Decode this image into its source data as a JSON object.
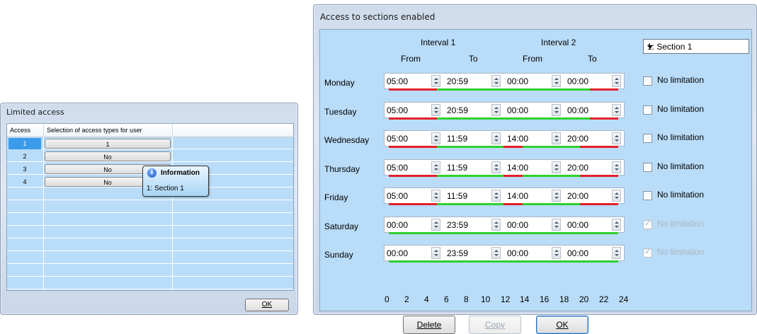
{
  "limited_access": {
    "title": "Limited access",
    "columns": [
      "Access",
      "Selection of access types for user"
    ],
    "rows": [
      {
        "num": "1",
        "value": "1",
        "selected": true
      },
      {
        "num": "2",
        "value": "No",
        "selected": false
      },
      {
        "num": "3",
        "value": "No",
        "selected": false
      },
      {
        "num": "4",
        "value": "No",
        "selected": false
      }
    ],
    "tooltip": {
      "title": "Information",
      "text": "1: Section 1",
      "icon": "info-icon"
    },
    "ok_label": "OK"
  },
  "sections": {
    "title": "Access to sections enabled",
    "interval1": "Interval 1",
    "interval2": "Interval 2",
    "from": "From",
    "to": "To",
    "section_select": "1: Section 1",
    "no_limitation": "No limitation",
    "days": [
      {
        "name": "Monday",
        "from1": "05:00",
        "to1": "20:59",
        "from2": "00:00",
        "to2": "00:00",
        "no_limit": false,
        "disabled": false
      },
      {
        "name": "Tuesday",
        "from1": "05:00",
        "to1": "20:59",
        "from2": "00:00",
        "to2": "00:00",
        "no_limit": false,
        "disabled": false
      },
      {
        "name": "Wednesday",
        "from1": "05:00",
        "to1": "11:59",
        "from2": "14:00",
        "to2": "20:00",
        "no_limit": false,
        "disabled": false
      },
      {
        "name": "Thursday",
        "from1": "05:00",
        "to1": "11:59",
        "from2": "14:00",
        "to2": "20:00",
        "no_limit": false,
        "disabled": false
      },
      {
        "name": "Friday",
        "from1": "05:00",
        "to1": "11:59",
        "from2": "14:00",
        "to2": "20:00",
        "no_limit": false,
        "disabled": false
      },
      {
        "name": "Saturday",
        "from1": "00:00",
        "to1": "23:59",
        "from2": "00:00",
        "to2": "00:00",
        "no_limit": true,
        "disabled": true
      },
      {
        "name": "Sunday",
        "from1": "00:00",
        "to1": "23:59",
        "from2": "00:00",
        "to2": "00:00",
        "no_limit": true,
        "disabled": true
      }
    ],
    "hour_ticks": [
      "0",
      "2",
      "4",
      "6",
      "8",
      "10",
      "12",
      "14",
      "16",
      "18",
      "20",
      "22",
      "24"
    ],
    "buttons": {
      "delete": "Delete",
      "copy": "Copy",
      "ok": "OK"
    },
    "colors": {
      "allowed": "#2fd02f",
      "blocked": "#e5202a"
    }
  }
}
